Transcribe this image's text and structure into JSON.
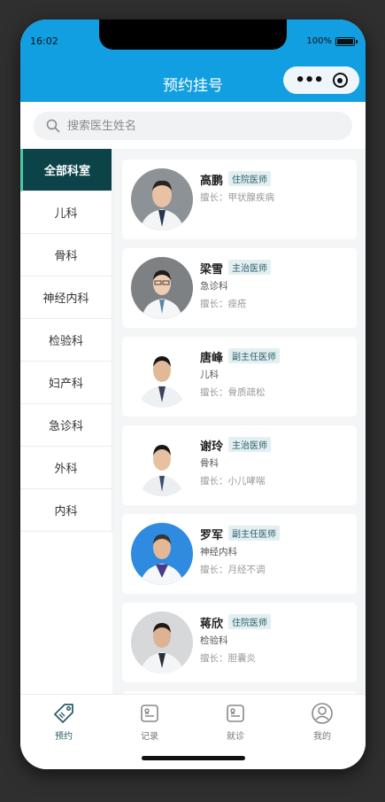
{
  "status": {
    "time": "16:02",
    "battery": "100%"
  },
  "nav": {
    "title": "预约挂号"
  },
  "search": {
    "placeholder": "搜索医生姓名"
  },
  "departments": [
    {
      "label": "全部科室",
      "active": true
    },
    {
      "label": "儿科"
    },
    {
      "label": "骨科"
    },
    {
      "label": "神经内科"
    },
    {
      "label": "检验科"
    },
    {
      "label": "妇产科"
    },
    {
      "label": "急诊科"
    },
    {
      "label": "外科"
    },
    {
      "label": "内科"
    }
  ],
  "doctors": [
    {
      "name": "高鹏",
      "title": "住院医师",
      "dept": "",
      "skill": "擅长：甲状腺疾病"
    },
    {
      "name": "梁雪",
      "title": "主治医师",
      "dept": "急诊科",
      "skill": "擅长：痤疮"
    },
    {
      "name": "唐峰",
      "title": "副主任医师",
      "dept": "儿科",
      "skill": "擅长：骨质疏松"
    },
    {
      "name": "谢玲",
      "title": "主治医师",
      "dept": "骨科",
      "skill": "擅长：小儿哮喘"
    },
    {
      "name": "罗军",
      "title": "副主任医师",
      "dept": "神经内科",
      "skill": "擅长：月经不调"
    },
    {
      "name": "蒋欣",
      "title": "住院医师",
      "dept": "检验科",
      "skill": "擅长：胆囊炎"
    }
  ],
  "tabs": [
    {
      "label": "预约",
      "icon": "tag-icon",
      "active": true
    },
    {
      "label": "记录",
      "icon": "record-icon"
    },
    {
      "label": "就诊",
      "icon": "visit-icon"
    },
    {
      "label": "我的",
      "icon": "profile-icon"
    }
  ],
  "colors": {
    "primary": "#119fe1",
    "accent": "#0b4349",
    "badge_text": "#2a5f69"
  }
}
